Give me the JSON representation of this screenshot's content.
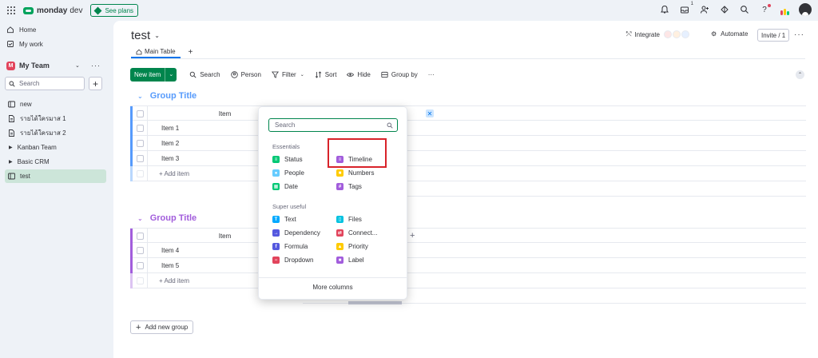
{
  "app": {
    "brand": "monday",
    "brand_sub": "dev",
    "see_plans": "See plans",
    "inbox_count": "1"
  },
  "sidebar": {
    "home": "Home",
    "my_work": "My work",
    "team_initial": "M",
    "team_name": "My Team",
    "search_placeholder": "Search",
    "boards": [
      {
        "label": "new",
        "icon": "board-icon"
      },
      {
        "label": "รายได้ใครมาส 1",
        "icon": "doc-icon"
      },
      {
        "label": "รายได้ใครมาส 2",
        "icon": "doc-icon"
      },
      {
        "label": "Kanban Team",
        "icon": "folder-caret"
      },
      {
        "label": "Basic CRM",
        "icon": "folder-caret"
      },
      {
        "label": "test",
        "icon": "board-icon"
      }
    ]
  },
  "board": {
    "title": "test",
    "integrate": "Integrate",
    "automate": "Automate",
    "invite": "Invite / 1",
    "tab_main": "Main Table",
    "tab_add": "+"
  },
  "toolbar": {
    "new_item": "New item",
    "search": "Search",
    "person": "Person",
    "filter": "Filter",
    "sort": "Sort",
    "hide": "Hide",
    "group_by": "Group by",
    "more": "···"
  },
  "groups": [
    {
      "title": "Group Title",
      "color": "#579bfc",
      "column_header": "Item",
      "items": [
        "Item 1",
        "Item 2",
        "Item 3"
      ],
      "add_item": "+ Add item"
    },
    {
      "title": "Group Title",
      "color": "#a25ddc",
      "column_header": "Item",
      "items": [
        "Item 4",
        "Item 5"
      ],
      "add_item": "+ Add item"
    }
  ],
  "add_new_group": "Add new group",
  "column_picker": {
    "search_placeholder": "Search",
    "essentials_label": "Essentials",
    "super_useful_label": "Super useful",
    "essentials": [
      {
        "label": "Status",
        "color": "#00c875"
      },
      {
        "label": "Timeline",
        "color": "#a25ddc"
      },
      {
        "label": "People",
        "color": "#66ccff"
      },
      {
        "label": "Numbers",
        "color": "#ffcb00"
      },
      {
        "label": "Date",
        "color": "#00c875"
      },
      {
        "label": "Tags",
        "color": "#a25ddc"
      }
    ],
    "super_useful": [
      {
        "label": "Text",
        "color": "#00a9ff"
      },
      {
        "label": "Files",
        "color": "#00c2e0"
      },
      {
        "label": "Dependency",
        "color": "#5559df"
      },
      {
        "label": "Connect...",
        "color": "#e2445c"
      },
      {
        "label": "Formula",
        "color": "#5559df"
      },
      {
        "label": "Priority",
        "color": "#ffcb00"
      },
      {
        "label": "Dropdown",
        "color": "#e2445c"
      },
      {
        "label": "Label",
        "color": "#a25ddc"
      }
    ],
    "more_columns": "More columns"
  }
}
